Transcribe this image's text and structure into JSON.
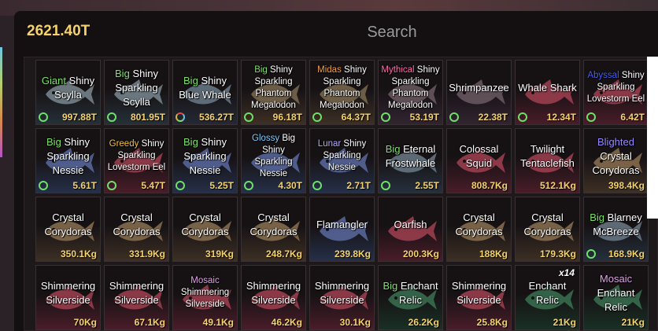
{
  "header": {
    "balance": "2621.40T",
    "search_placeholder": "Search"
  },
  "colors": {
    "balance": "#f5d26a",
    "value": "#f5d26a",
    "favorite_ring": "#6ee06a",
    "Giant": "#7ee06a",
    "Big": "#7ee06a",
    "Midas": "#f0a040",
    "Mythical": "#ff6aa8",
    "Abyssal": "#4a5cff",
    "Greedy": "#f0c040",
    "Glossy": "#7ecbff",
    "Lunar": "#b8a8ff",
    "Blighted": "#9a8aff",
    "Mosaic": "#e0a0e8"
  },
  "inventory": [
    {
      "mutation": "Giant",
      "name": "Shiny Scylla",
      "value": "997.88T",
      "ring": "green",
      "tint": "#2a3a44",
      "fish": "#7a8890"
    },
    {
      "mutation": "Big",
      "name": "Shiny Sparkling Scylla",
      "value": "801.95T",
      "ring": "green",
      "tint": "#2a3a44",
      "fish": "#7a8890"
    },
    {
      "mutation": "Big",
      "name": "Shiny Blue Whale",
      "value": "536.27T",
      "ring": "rainbow",
      "tint": "#2a3040",
      "fish": "#6a7a8a"
    },
    {
      "mutation": "Big",
      "name": "Shiny Sparkling Phantom Megalodon",
      "value": "96.18T",
      "ring": "green",
      "tint": "#4a3a2a",
      "fish": "#7a6a50"
    },
    {
      "mutation": "Midas",
      "name": "Shiny Sparkling Phantom Megalodon",
      "value": "64.37T",
      "ring": "green",
      "tint": "#4a3a2a",
      "fish": "#7a6a50"
    },
    {
      "mutation": "Mythical",
      "name": "Shiny Sparkling Phantom Megalodon",
      "value": "53.19T",
      "ring": "green",
      "tint": "#3a2a3a",
      "fish": "#6a5a60"
    },
    {
      "mutation": "",
      "name": "Shrimpanzee",
      "value": "22.38T",
      "ring": "green",
      "tint": "#3a2a3a",
      "fish": "#6a5a60"
    },
    {
      "mutation": "",
      "name": "Whale Shark",
      "value": "12.34T",
      "ring": "green",
      "tint": "#5a2030",
      "fish": "#a04050"
    },
    {
      "mutation": "Abyssal",
      "name": "Shiny Sparkling Lovestorm Eel",
      "value": "6.42T",
      "ring": "green",
      "tint": "#5a2030",
      "fish": "#a04050"
    },
    {
      "mutation": "Big",
      "name": "Shiny Sparkling Nessie",
      "value": "5.61T",
      "ring": "green",
      "tint": "#2a3a5a",
      "fish": "#5a6aa0"
    },
    {
      "mutation": "Greedy",
      "name": "Shiny Sparkling Lovestorm Eel",
      "value": "5.47T",
      "ring": "green",
      "tint": "#5a2030",
      "fish": "#a04050"
    },
    {
      "mutation": "Big",
      "name": "Shiny Sparkling Nessie",
      "value": "5.25T",
      "ring": "green",
      "tint": "#2a3a5a",
      "fish": "#5a6aa0"
    },
    {
      "mutation": "Glossy",
      "name": "Big Shiny Sparkling Nessie",
      "value": "4.30T",
      "ring": "green",
      "tint": "#2a3a5a",
      "fish": "#5a6aa0"
    },
    {
      "mutation": "Lunar",
      "name": "Shiny Sparkling Nessie",
      "value": "2.71T",
      "ring": "green",
      "tint": "#2a3a5a",
      "fish": "#5a6aa0"
    },
    {
      "mutation": "Big",
      "name": "Eternal Frostwhale",
      "value": "2.55T",
      "ring": "green",
      "tint": "#2a3a4a",
      "fish": "#6a7a88"
    },
    {
      "mutation": "",
      "name": "Colossal Squid",
      "value": "808.7Kg",
      "ring": "",
      "tint": "#5a2030",
      "fish": "#a04050"
    },
    {
      "mutation": "",
      "name": "Twilight Tentaclefish",
      "value": "512.1Kg",
      "ring": "",
      "tint": "#5a2030",
      "fish": "#a04050"
    },
    {
      "mutation": "Blighted",
      "name": "Crystal Corydoras",
      "value": "398.4Kg",
      "ring": "",
      "tint": "#4a3a2a",
      "fish": "#8a7050"
    },
    {
      "mutation": "",
      "name": "Crystal Corydoras",
      "value": "350.1Kg",
      "ring": "",
      "tint": "#4a3a2a",
      "fish": "#8a7050"
    },
    {
      "mutation": "",
      "name": "Crystal Corydoras",
      "value": "331.9Kg",
      "ring": "",
      "tint": "#4a3a2a",
      "fish": "#8a7050"
    },
    {
      "mutation": "",
      "name": "Crystal Corydoras",
      "value": "319Kg",
      "ring": "",
      "tint": "#4a3a2a",
      "fish": "#8a7050"
    },
    {
      "mutation": "",
      "name": "Crystal Corydoras",
      "value": "248.7Kg",
      "ring": "",
      "tint": "#4a3a2a",
      "fish": "#8a7050"
    },
    {
      "mutation": "",
      "name": "Flamangler",
      "value": "239.8Kg",
      "ring": "",
      "tint": "#2a3a5a",
      "fish": "#5a6aa0"
    },
    {
      "mutation": "",
      "name": "Oarfish",
      "value": "200.3Kg",
      "ring": "",
      "tint": "#5a2030",
      "fish": "#a04050"
    },
    {
      "mutation": "",
      "name": "Crystal Corydoras",
      "value": "188Kg",
      "ring": "",
      "tint": "#4a3a2a",
      "fish": "#8a7050"
    },
    {
      "mutation": "",
      "name": "Crystal Corydoras",
      "value": "179.3Kg",
      "ring": "",
      "tint": "#4a3a2a",
      "fish": "#8a7050"
    },
    {
      "mutation": "Big",
      "name": "Blarney McBreeze",
      "value": "168.9Kg",
      "ring": "green",
      "tint": "#2a3a4a",
      "fish": "#6a7a88"
    },
    {
      "mutation": "",
      "name": "Shimmering Silverside",
      "value": "70Kg",
      "ring": "",
      "tint": "#5a2030",
      "fish": "#a04050"
    },
    {
      "mutation": "",
      "name": "Shimmering Silverside",
      "value": "67.1Kg",
      "ring": "",
      "tint": "#5a2030",
      "fish": "#a04050"
    },
    {
      "mutation": "Mosaic",
      "name": "Shimmering Silverside",
      "value": "49.1Kg",
      "ring": "",
      "tint": "#5a2030",
      "fish": "#a04050"
    },
    {
      "mutation": "",
      "name": "Shimmering Silverside",
      "value": "46.2Kg",
      "ring": "",
      "tint": "#5a2030",
      "fish": "#a04050"
    },
    {
      "mutation": "",
      "name": "Shimmering Silverside",
      "value": "30.1Kg",
      "ring": "",
      "tint": "#5a2030",
      "fish": "#a04050"
    },
    {
      "mutation": "Big",
      "name": "Enchant Relic",
      "value": "26.2Kg",
      "ring": "",
      "tint": "#1a3a2a",
      "fish": "#3a7050"
    },
    {
      "mutation": "",
      "name": "Shimmering Silverside",
      "value": "25.8Kg",
      "ring": "",
      "tint": "#5a2030",
      "fish": "#a04050"
    },
    {
      "mutation": "",
      "name": "Enchant Relic",
      "value": "21Kg",
      "ring": "",
      "tint": "#1a3a2a",
      "fish": "#3a7050",
      "count": "x14"
    },
    {
      "mutation": "Mosaic",
      "name": "Enchant Relic",
      "value": "21Kg",
      "ring": "",
      "tint": "#1a3a2a",
      "fish": "#3a7050"
    }
  ]
}
